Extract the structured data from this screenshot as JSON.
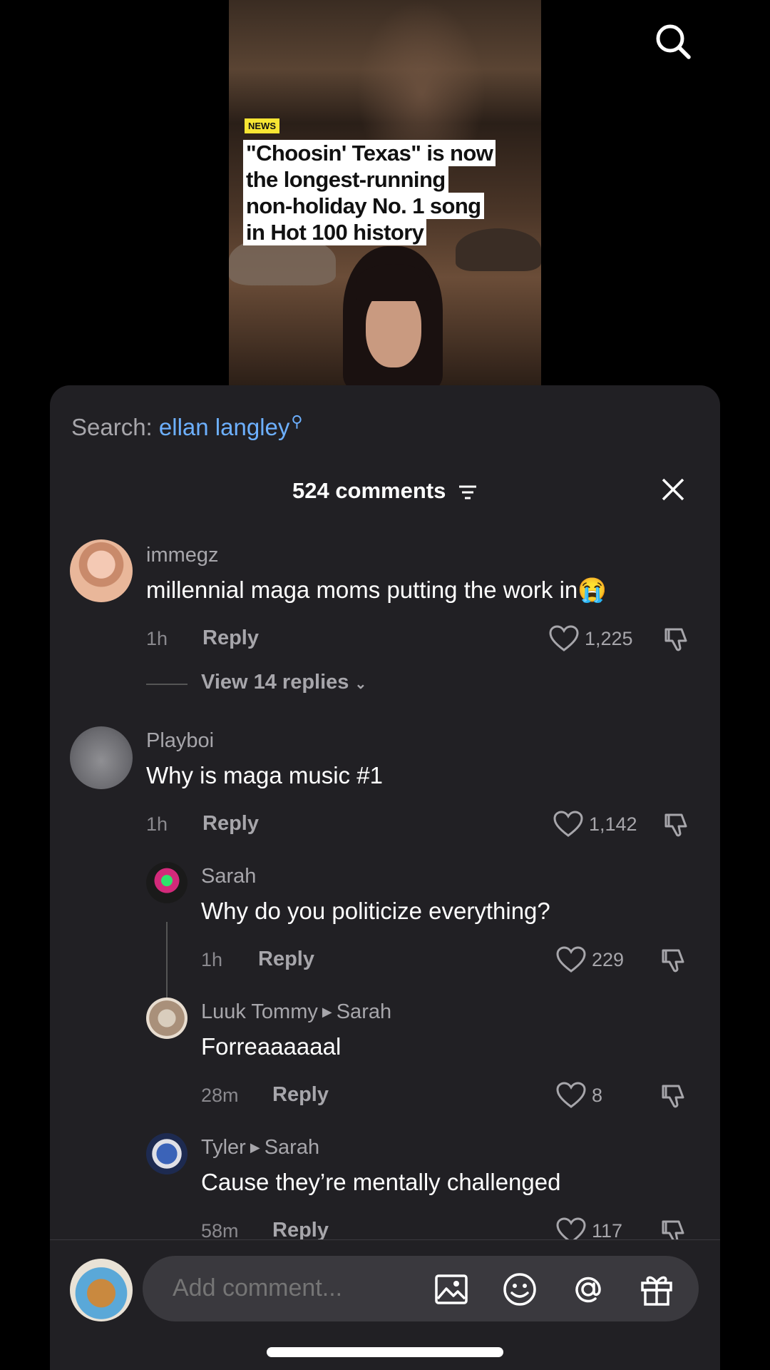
{
  "video": {
    "badge": "NEWS",
    "headline": [
      "\"Choosin' Texas\" is now",
      "the longest-running",
      "non-holiday No. 1 song",
      "in Hot 100 history"
    ]
  },
  "search_hint": {
    "label": "Search:",
    "term": "ellan langley"
  },
  "comments_header": {
    "count_label": "524 comments"
  },
  "comments": [
    {
      "user": "immegz",
      "text": "millennial maga moms putting the work in😭",
      "time": "1h",
      "reply": "Reply",
      "likes": "1,225",
      "view_replies": "View 14 replies"
    },
    {
      "user": "Playboi",
      "text": "Why is maga music #1",
      "time": "1h",
      "reply": "Reply",
      "likes": "1,142"
    },
    {
      "user": "Sarah",
      "text": "Why do you politicize everything?",
      "time": "1h",
      "reply": "Reply",
      "likes": "229"
    },
    {
      "user": "Luuk Tommy",
      "reply_to": "Sarah",
      "text": "Forreaaaaaal",
      "time": "28m",
      "reply": "Reply",
      "likes": "8"
    },
    {
      "user": "Tyler",
      "reply_to": "Sarah",
      "text": "Cause they’re mentally challenged",
      "time": "58m",
      "reply": "Reply",
      "likes": "117"
    }
  ],
  "composer": {
    "placeholder": "Add comment..."
  },
  "icons": {
    "top": "search-icon",
    "composer": [
      "image-icon",
      "emoji-icon",
      "mention-icon",
      "gift-icon"
    ]
  },
  "colors": {
    "sheet": "#212024",
    "link": "#6db0ff",
    "badge": "#f7e533"
  }
}
